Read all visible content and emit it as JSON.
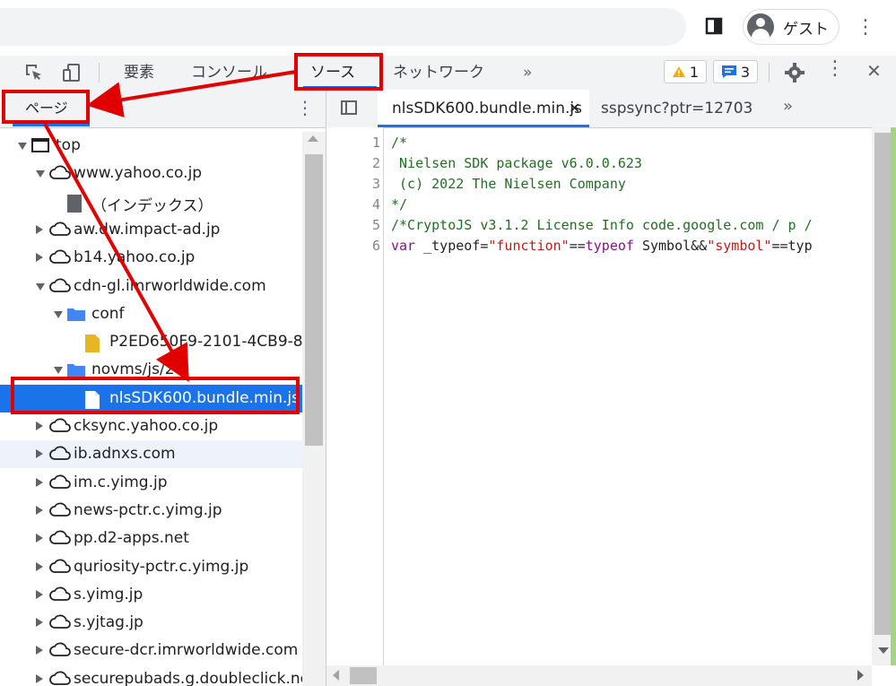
{
  "browser": {
    "profile_label": "ゲスト",
    "icons": [
      "split-screen-icon",
      "profile-avatar-icon",
      "kebab-menu-icon"
    ]
  },
  "devtools": {
    "tabs": [
      {
        "label": "要素"
      },
      {
        "label": "コンソール"
      },
      {
        "label": "ソース",
        "active": true
      },
      {
        "label": "ネットワーク"
      }
    ],
    "more_tabs": "»",
    "warnings_count": "1",
    "messages_count": "3",
    "close_glyph": "✕",
    "accent_color": "#1a73e8"
  },
  "navigator": {
    "tab_label": "ページ",
    "more": "»",
    "tree": [
      {
        "label": "top",
        "type": "frame",
        "expanded": true,
        "level": 0
      },
      {
        "label": "www.yahoo.co.jp",
        "type": "domain",
        "expanded": true,
        "level": 1
      },
      {
        "label": "（インデックス）",
        "type": "document",
        "level": 2
      },
      {
        "label": "aw.dw.impact-ad.jp",
        "type": "domain",
        "expanded": false,
        "level": 1
      },
      {
        "label": "b14.yahoo.co.jp",
        "type": "domain",
        "expanded": false,
        "level": 1
      },
      {
        "label": "cdn-gl.imrworldwide.com",
        "type": "domain",
        "expanded": true,
        "level": 1
      },
      {
        "label": "conf",
        "type": "folder",
        "expanded": true,
        "level": 2
      },
      {
        "label": "P2ED650F9-2101-4CB9-8",
        "type": "script-file",
        "level": 3
      },
      {
        "label": "novms/js/2",
        "type": "folder",
        "expanded": true,
        "level": 2
      },
      {
        "label": "nlsSDK600.bundle.min.js",
        "type": "file",
        "level": 3,
        "selected": true
      },
      {
        "label": "cksync.yahoo.co.jp",
        "type": "domain",
        "expanded": false,
        "level": 1
      },
      {
        "label": "ib.adnxs.com",
        "type": "domain",
        "expanded": false,
        "level": 1,
        "hover": true
      },
      {
        "label": "im.c.yimg.jp",
        "type": "domain",
        "expanded": false,
        "level": 1
      },
      {
        "label": "news-pctr.c.yimg.jp",
        "type": "domain",
        "expanded": false,
        "level": 1
      },
      {
        "label": "pp.d2-apps.net",
        "type": "domain",
        "expanded": false,
        "level": 1
      },
      {
        "label": "quriosity-pctr.c.yimg.jp",
        "type": "domain",
        "expanded": false,
        "level": 1
      },
      {
        "label": "s.yimg.jp",
        "type": "domain",
        "expanded": false,
        "level": 1
      },
      {
        "label": "s.yjtag.jp",
        "type": "domain",
        "expanded": false,
        "level": 1
      },
      {
        "label": "secure-dcr.imrworldwide.com",
        "type": "domain",
        "expanded": false,
        "level": 1
      },
      {
        "label": "securepubads.g.doubleclick.net",
        "type": "domain",
        "expanded": false,
        "level": 1
      }
    ]
  },
  "editor": {
    "tabs": [
      {
        "label": "nlsSDK600.bundle.min.js",
        "active": true,
        "close": "✕"
      },
      {
        "label": "sspsync?ptr=12703"
      }
    ],
    "more": "»",
    "lines": [
      {
        "n": "1",
        "parts": [
          {
            "t": "/*",
            "c": "cm"
          }
        ]
      },
      {
        "n": "2",
        "parts": [
          {
            "t": " Nielsen SDK package v6.0.0.623",
            "c": "cm"
          }
        ]
      },
      {
        "n": "3",
        "parts": [
          {
            "t": " (c) 2022 The Nielsen Company",
            "c": "cm"
          }
        ]
      },
      {
        "n": "4",
        "parts": [
          {
            "t": "*/",
            "c": "cm"
          }
        ]
      },
      {
        "n": "5",
        "parts": [
          {
            "t": "/*CryptoJS v3.1.2 License Info code.google.com / p /",
            "c": "cm"
          }
        ]
      },
      {
        "n": "6",
        "parts": [
          {
            "t": "var",
            "c": "kw"
          },
          {
            "t": " _typeof=",
            "c": ""
          },
          {
            "t": "\"function\"",
            "c": "str2"
          },
          {
            "t": "==",
            "c": ""
          },
          {
            "t": "typeof",
            "c": "kw"
          },
          {
            "t": " Symbol&&",
            "c": ""
          },
          {
            "t": "\"symbol\"",
            "c": "str2"
          },
          {
            "t": "==typ",
            "c": ""
          }
        ]
      }
    ]
  },
  "annotation_color": "#e00000"
}
